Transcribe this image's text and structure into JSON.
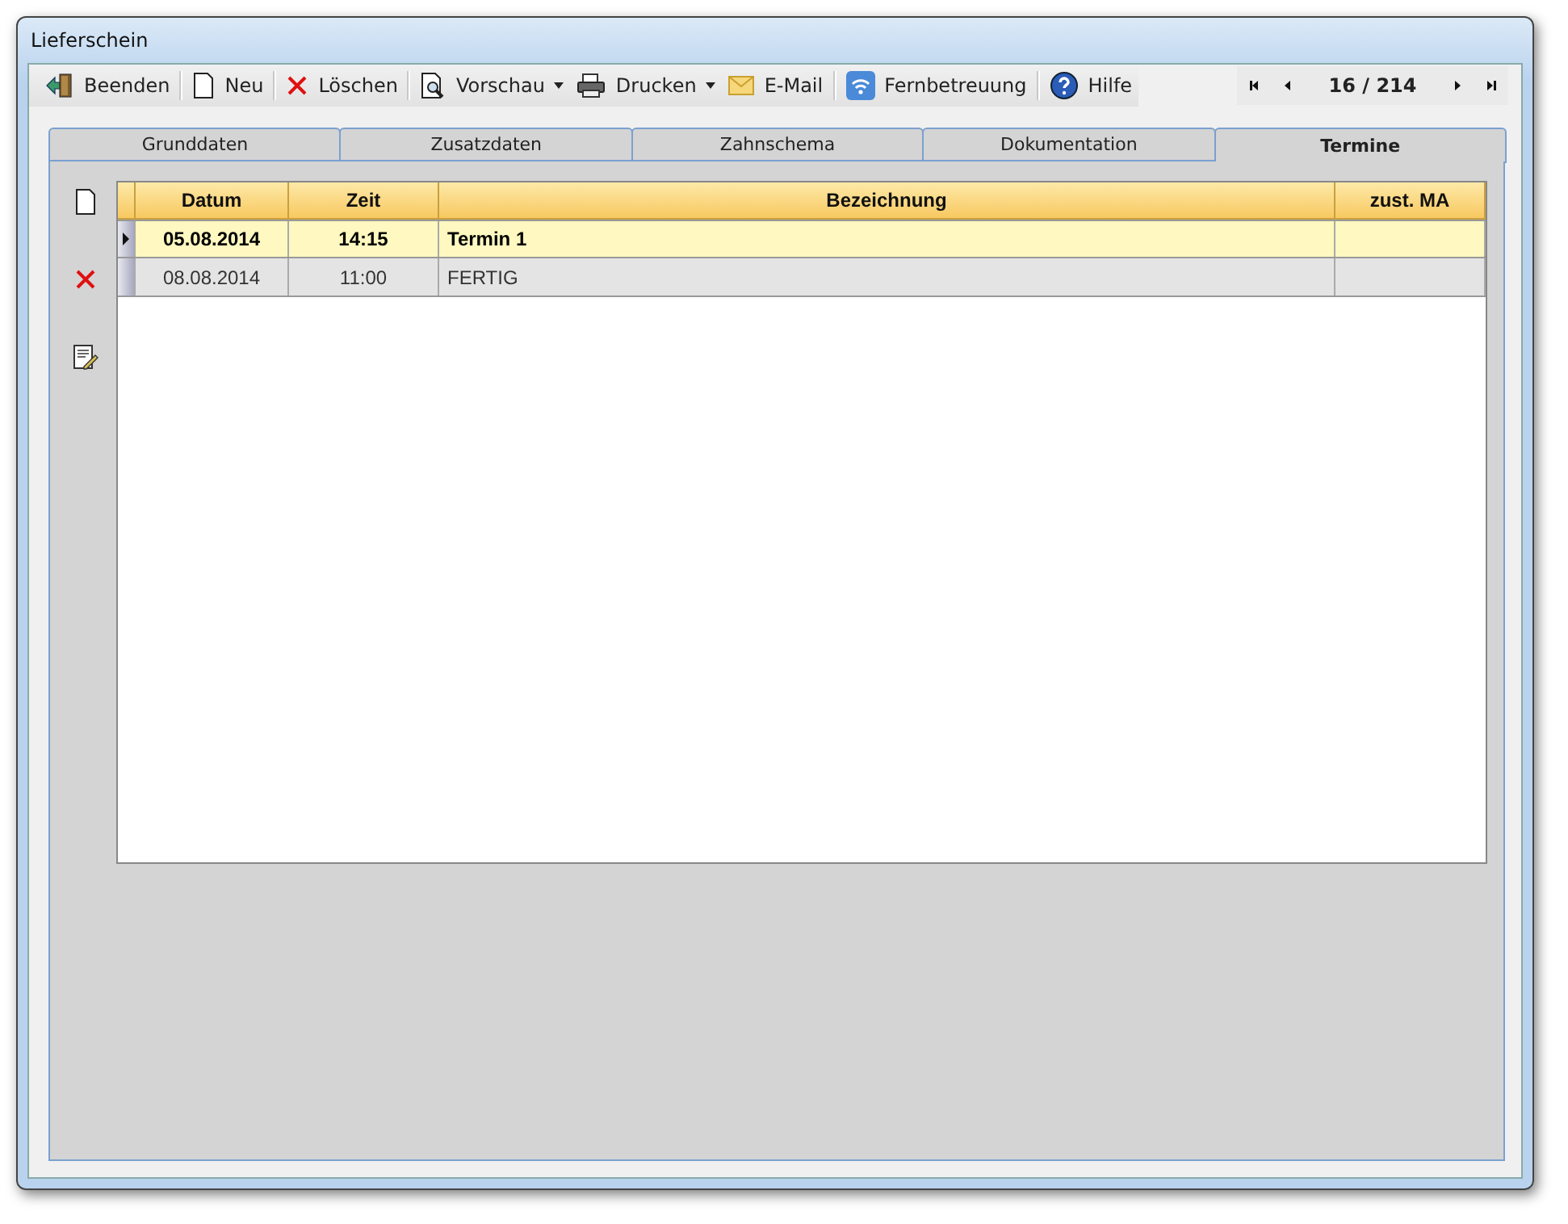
{
  "window": {
    "title": "Lieferschein"
  },
  "toolbar": [
    {
      "label": "Beenden",
      "dropdown": false
    },
    {
      "label": "Neu",
      "dropdown": false
    },
    {
      "label": "Löschen",
      "dropdown": false
    },
    {
      "label": "Vorschau",
      "dropdown": true
    },
    {
      "label": "Drucken",
      "dropdown": true
    },
    {
      "label": "E-Mail",
      "dropdown": false
    },
    {
      "label": "Fernbetreuung",
      "dropdown": false
    },
    {
      "label": "Hilfe",
      "dropdown": false
    }
  ],
  "navigator": {
    "record": "16 / 214"
  },
  "tabs": [
    {
      "label": "Grunddaten",
      "selected": false
    },
    {
      "label": "Zusatzdaten",
      "selected": false
    },
    {
      "label": "Zahnschema",
      "selected": false
    },
    {
      "label": "Dokumentation",
      "selected": false
    },
    {
      "label": "Termine",
      "selected": true
    }
  ],
  "table": {
    "columns": [
      "Datum",
      "Zeit",
      "Bezeichnung",
      "zust. MA"
    ],
    "rows": [
      {
        "cells": [
          "05.08.2014",
          "14:15",
          "Termin 1",
          ""
        ],
        "selected": true
      },
      {
        "cells": [
          "08.08.2014",
          "11:00",
          "FERTIG",
          ""
        ],
        "selected": false
      }
    ]
  }
}
